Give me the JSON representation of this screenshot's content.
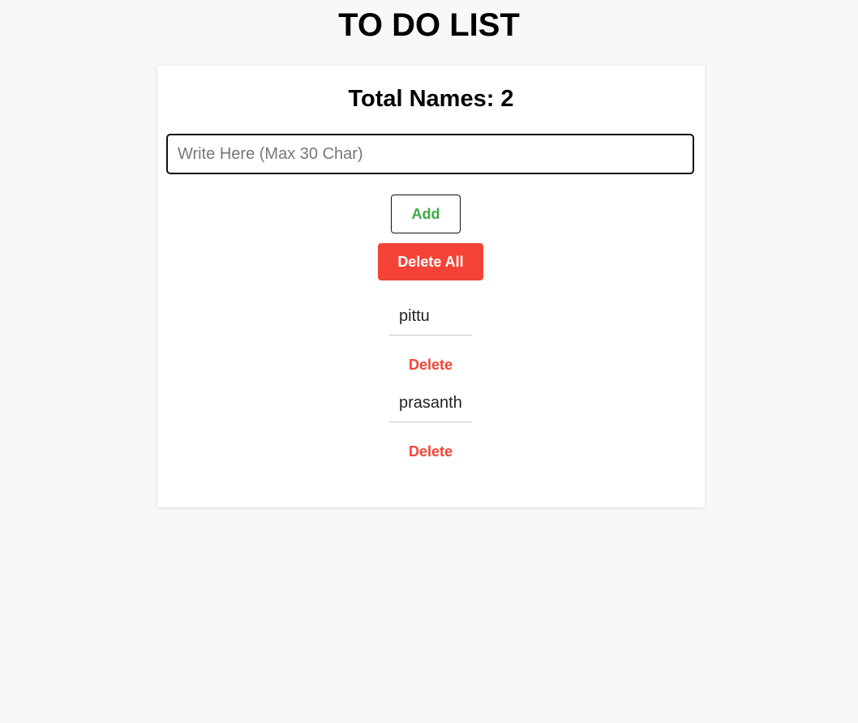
{
  "app": {
    "title": "TO DO LIST"
  },
  "counter": {
    "label": "Total Names: 2"
  },
  "input": {
    "value": "",
    "placeholder": "Write Here (Max 30 Char)"
  },
  "buttons": {
    "add_label": "Add",
    "delete_all_label": "Delete All"
  },
  "items": [
    {
      "name": "pittu",
      "delete_label": "Delete"
    },
    {
      "name": "prasanth",
      "delete_label": "Delete"
    }
  ],
  "colors": {
    "page_background": "#f8f8f8",
    "card_background": "#ffffff",
    "add_text": "#3cab45",
    "danger": "#f44336"
  }
}
